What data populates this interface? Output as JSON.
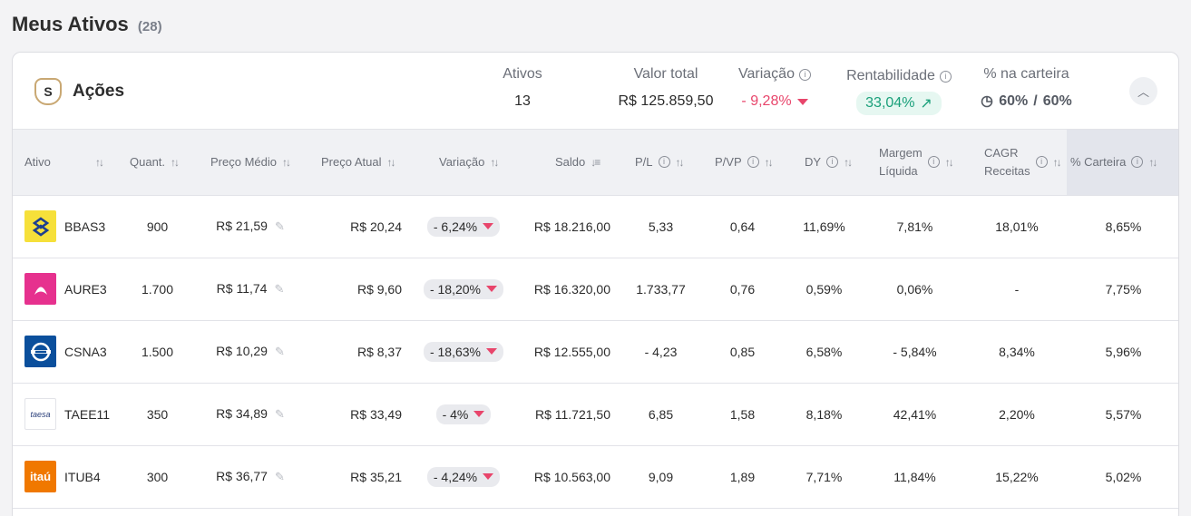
{
  "page": {
    "title": "Meus Ativos",
    "count": "(28)"
  },
  "category": {
    "icon": "s-badge-icon",
    "icon_letter": "S",
    "label": "Ações"
  },
  "summary": {
    "ativos": {
      "label": "Ativos",
      "value": "13"
    },
    "valor_total": {
      "label": "Valor total",
      "value": "R$ 125.859,50"
    },
    "variacao": {
      "label": "Variação",
      "value": "- 9,28%"
    },
    "rentabilidade": {
      "label": "Rentabilidade",
      "value": "33,04%"
    },
    "carteira": {
      "label": "% na carteira",
      "value_a": "60%",
      "sep": "/",
      "value_b": "60%"
    }
  },
  "columns": {
    "ativo": "Ativo",
    "quant": "Quant.",
    "preco_medio": "Preço Médio",
    "preco_atual": "Preço Atual",
    "variacao": "Variação",
    "saldo": "Saldo",
    "pl": "P/L",
    "pvp": "P/VP",
    "dy": "DY",
    "margem_1": "Margem",
    "margem_2": "Líquida",
    "cagr_1": "CAGR",
    "cagr_2": "Receitas",
    "carteira": "% Carteira"
  },
  "rows": [
    {
      "ticker": "BBAS3",
      "logo": "banco-do-brasil-logo",
      "quant": "900",
      "preco_medio": "R$ 21,59",
      "preco_atual": "R$ 20,24",
      "variacao": "- 6,24%",
      "saldo": "R$ 18.216,00",
      "pl": "5,33",
      "pvp": "0,64",
      "dy": "11,69%",
      "margem": "7,81%",
      "cagr": "18,01%",
      "carteira": "8,65%"
    },
    {
      "ticker": "AURE3",
      "logo": "auren-logo",
      "quant": "1.700",
      "preco_medio": "R$ 11,74",
      "preco_atual": "R$ 9,60",
      "variacao": "- 18,20%",
      "saldo": "R$ 16.320,00",
      "pl": "1.733,77",
      "pvp": "0,76",
      "dy": "0,59%",
      "margem": "0,06%",
      "cagr": "-",
      "carteira": "7,75%"
    },
    {
      "ticker": "CSNA3",
      "logo": "csn-logo",
      "quant": "1.500",
      "preco_medio": "R$ 10,29",
      "preco_atual": "R$ 8,37",
      "variacao": "- 18,63%",
      "saldo": "R$ 12.555,00",
      "pl": "- 4,23",
      "pvp": "0,85",
      "dy": "6,58%",
      "margem": "- 5,84%",
      "cagr": "8,34%",
      "carteira": "5,96%"
    },
    {
      "ticker": "TAEE11",
      "logo": "taesa-logo",
      "logo_text": "taesa",
      "quant": "350",
      "preco_medio": "R$ 34,89",
      "preco_atual": "R$ 33,49",
      "variacao": "- 4%",
      "saldo": "R$ 11.721,50",
      "pl": "6,85",
      "pvp": "1,58",
      "dy": "8,18%",
      "margem": "42,41%",
      "cagr": "2,20%",
      "carteira": "5,57%"
    },
    {
      "ticker": "ITUB4",
      "logo": "itau-logo",
      "logo_text": "itaú",
      "quant": "300",
      "preco_medio": "R$ 36,77",
      "preco_atual": "R$ 35,21",
      "variacao": "- 4,24%",
      "saldo": "R$ 10.563,00",
      "pl": "9,09",
      "pvp": "1,89",
      "dy": "7,71%",
      "margem": "11,84%",
      "cagr": "15,22%",
      "carteira": "5,02%"
    }
  ],
  "colors": {
    "negative": "#e8456b",
    "positive": "#1aa07a",
    "bb": "#f6e03a",
    "aure": "#e6318e",
    "csn": "#0b4f9c",
    "itau": "#f07800"
  }
}
